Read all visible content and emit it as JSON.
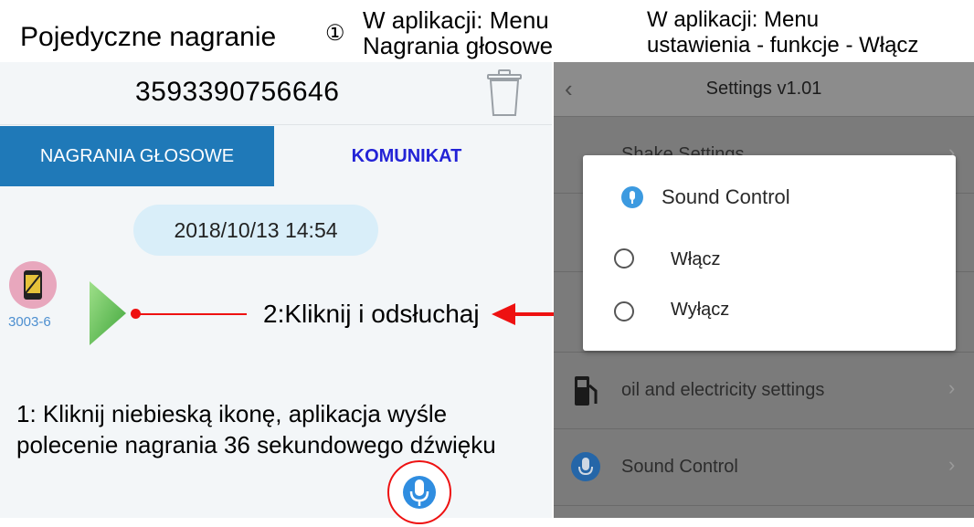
{
  "captions": {
    "main": "Pojedyczne nagranie",
    "circle_one": "①",
    "menu_left_line1": "W aplikacji: Menu",
    "menu_left_line2": "Nagrania głosowe",
    "menu_right_line1": "W aplikacji: Menu",
    "menu_right_line2": "ustawienia - funkcje - Włącz"
  },
  "left_phone": {
    "phone_number": "3593390756646",
    "tab_voice": "NAGRANIA GŁOSOWE",
    "tab_message": "KOMUNIKAT",
    "date": "2018/10/13 14:54",
    "device_label": "3003-6",
    "click_label": "2:Kliknij i odsłuchaj",
    "instruction_line1": "1: Kliknij niebieską ikonę, aplikacja wyśle",
    "instruction_line2": "polecenie nagrania 36 sekundowego dźwięku"
  },
  "right_phone": {
    "title": "Settings v1.01",
    "back_glyph": "‹",
    "rows": [
      {
        "label": "Shake Settings"
      },
      {
        "label": "oil and electricity settings"
      },
      {
        "label": "Sound Control"
      }
    ],
    "chevron": "›",
    "dialog": {
      "title": "Sound Control",
      "options": [
        "Włącz",
        "Wyłącz"
      ]
    }
  },
  "icons": {
    "trash": "trash-icon",
    "play": "play-icon",
    "mic": "microphone-icon",
    "avatar": "watch-avatar-icon",
    "fuel": "fuel-pump-icon",
    "sound": "sound-control-icon"
  },
  "colors": {
    "tab_active_bg": "#1f79b8",
    "tab_inactive_text": "#2323d6",
    "annotation_red": "#e11111",
    "date_pill_bg": "#d9eef9",
    "dialog_icon": "#3c9ae0"
  }
}
